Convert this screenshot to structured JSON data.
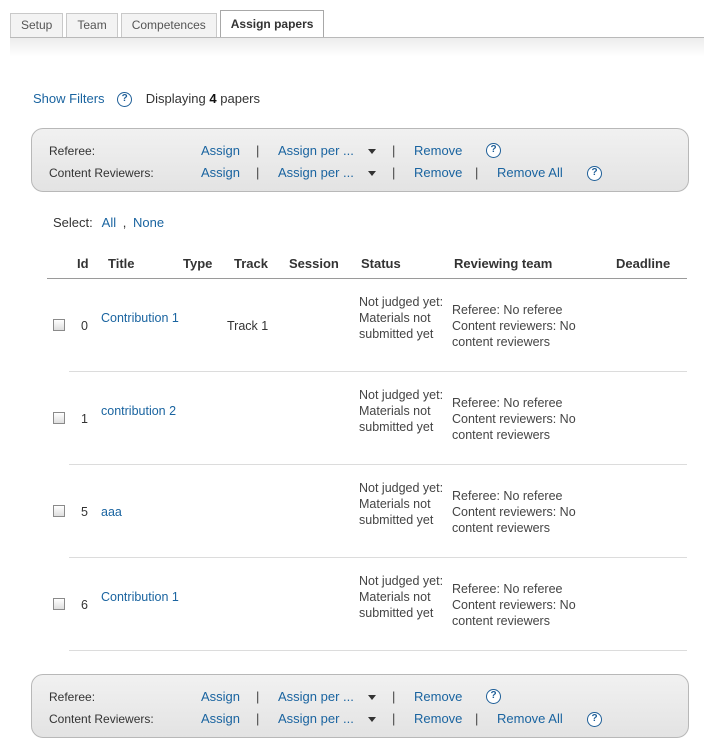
{
  "tabs": [
    {
      "label": "Setup"
    },
    {
      "label": "Team"
    },
    {
      "label": "Competences"
    },
    {
      "label": "Assign papers",
      "active": true
    }
  ],
  "filter": {
    "show_filters": "Show Filters",
    "displaying_prefix": "Displaying",
    "count": "4",
    "displaying_suffix": "papers"
  },
  "actions": {
    "referee_label": "Referee:",
    "reviewers_label": "Content Reviewers:",
    "assign": "Assign",
    "assign_per": "Assign per ...",
    "remove": "Remove",
    "remove_all": "Remove All",
    "separator": "|",
    "help": "?"
  },
  "select": {
    "label": "Select:",
    "all": "All",
    "comma": ",",
    "none": "None"
  },
  "table": {
    "headers": [
      "Id",
      "Title",
      "Type",
      "Track",
      "Session",
      "Status",
      "Reviewing team",
      "Deadline"
    ],
    "rows": [
      {
        "id": "0",
        "title": "Contribution 1",
        "track": "Track 1",
        "status": "Not judged yet: Materials not submitted yet",
        "team": "Referee: No referee Content reviewers: No content reviewers"
      },
      {
        "id": "1",
        "title": "contribution 2",
        "track": "",
        "status": "Not judged yet: Materials not submitted yet",
        "team": "Referee: No referee Content reviewers: No content reviewers"
      },
      {
        "id": "5",
        "title": "aaa",
        "track": "",
        "status": "Not judged yet: Materials not submitted yet",
        "team": "Referee: No referee Content reviewers: No content reviewers"
      },
      {
        "id": "6",
        "title": "Contribution 1",
        "track": "",
        "status": "Not judged yet: Materials not submitted yet",
        "team": "Referee: No referee Content reviewers: No content reviewers"
      }
    ]
  }
}
